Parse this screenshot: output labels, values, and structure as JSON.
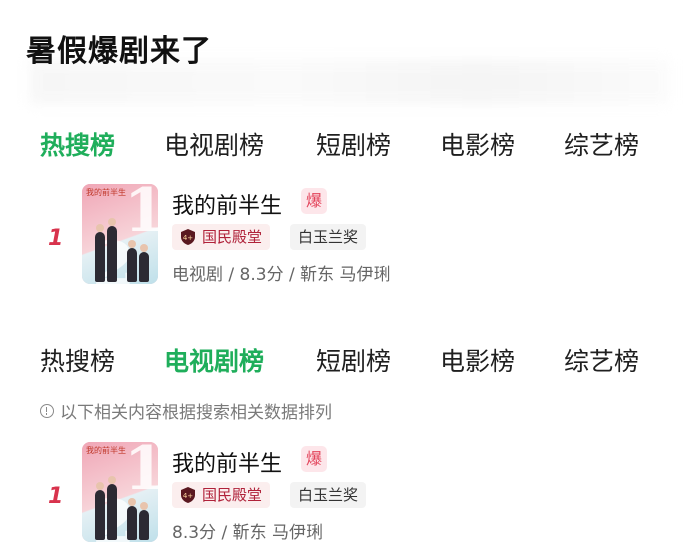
{
  "page": {
    "title": "暑假爆剧来了"
  },
  "tabs_block1": {
    "items": [
      {
        "label": "热搜榜",
        "active": true
      },
      {
        "label": "电视剧榜",
        "active": false
      },
      {
        "label": "短剧榜",
        "active": false
      },
      {
        "label": "电影榜",
        "active": false
      },
      {
        "label": "综艺榜",
        "active": false
      }
    ]
  },
  "item1": {
    "rank": "1",
    "title": "我的前半生",
    "hot_badge": "爆",
    "award_tag": "国民殿堂",
    "award_icon_text": "4+",
    "tag2": "白玉兰奖",
    "meta": "电视剧 / 8.3分 / 靳东 马伊琍",
    "poster_caption": "我的前半生"
  },
  "tabs_block2": {
    "items": [
      {
        "label": "热搜榜",
        "active": false
      },
      {
        "label": "电视剧榜",
        "active": true
      },
      {
        "label": "短剧榜",
        "active": false
      },
      {
        "label": "电影榜",
        "active": false
      },
      {
        "label": "综艺榜",
        "active": false
      }
    ]
  },
  "note": {
    "text": "以下相关内容根据搜索相关数据排列"
  },
  "item2": {
    "rank": "1",
    "title": "我的前半生",
    "hot_badge": "爆",
    "award_tag": "国民殿堂",
    "award_icon_text": "4+",
    "tag2": "白玉兰奖",
    "meta": "8.3分 / 靳东 马伊琍",
    "poster_caption": "我的前半生"
  },
  "colors": {
    "active_tab": "#1fae5b",
    "rank": "#d8334d",
    "hot_badge_bg": "#fde6ea",
    "award_text": "#b0223a"
  }
}
